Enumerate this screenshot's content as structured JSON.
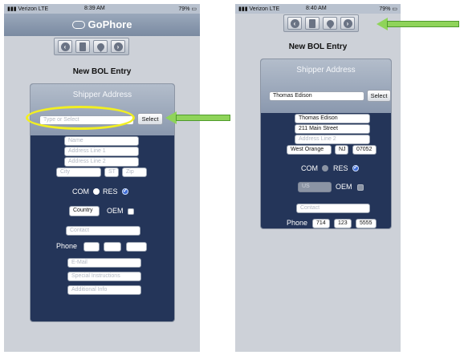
{
  "left_phone": {
    "status": {
      "carrier": "Verizon",
      "network": "LTE",
      "time": "8:39 AM",
      "battery": "79%"
    },
    "app_title": "GoPhore",
    "heading": "New BOL Entry",
    "card_title": "Shipper Address",
    "search": {
      "placeholder": "Type or Select",
      "select_label": "Select"
    },
    "fields": {
      "name": "Name",
      "address1": "Address Line 1",
      "address2": "Address Line 2",
      "city": "City",
      "state": "ST",
      "zip": "Zip",
      "com_label": "COM",
      "res_label": "RES",
      "country": "Country",
      "oem_label": "OEM",
      "contact": "Contact",
      "phone_label": "Phone",
      "email": "E-Mail",
      "special": "Special Instructions",
      "additional": "Additional Info"
    }
  },
  "right_phone": {
    "status": {
      "carrier": "Verizon",
      "network": "LTE",
      "time": "8:40 AM",
      "battery": "79%"
    },
    "heading": "New BOL Entry",
    "card_title": "Shipper Address",
    "search": {
      "value": "Thomas Edison",
      "select_label": "Select"
    },
    "fields": {
      "name": "Thomas Edison",
      "address1": "211 Main Street",
      "address2": "Address Line 2",
      "city": "West Orange",
      "state": "NJ",
      "zip": "07052",
      "com_label": "COM",
      "res_label": "RES",
      "country": "US",
      "oem_label": "OEM",
      "contact": "Contact",
      "phone_label": "Phone",
      "phone1": "714",
      "phone2": "123",
      "phone3": "5555"
    }
  },
  "colors": {
    "card_bg": "#243559",
    "highlight": "#f2ef21",
    "arrow": "#8fd45a"
  },
  "icons": [
    "back-icon",
    "trash-icon",
    "location-pin-icon",
    "forward-icon",
    "cloud-icon",
    "checkmark-icon"
  ]
}
